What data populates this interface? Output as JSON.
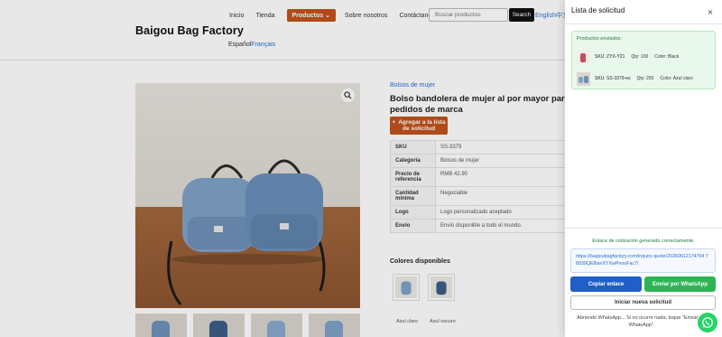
{
  "header": {
    "brand": "Baigou Bag Factory",
    "nav": [
      "Inicio",
      "Tienda"
    ],
    "nav_active": "Productos",
    "nav_active_caret": "⌄",
    "nav_more": [
      "Sobre nosotros",
      "Contáctanos"
    ],
    "search": {
      "placeholder": "Buscar productos",
      "button": "Search"
    },
    "lang_top": "English中文",
    "lang_bottom": {
      "es": "Español",
      "fr": "Français"
    }
  },
  "product": {
    "breadcrumb": "Bolsos de mujer",
    "title": "Bolso bandolera de mujer al por mayor para pedidos de marca",
    "add_button": {
      "plus": "+",
      "label": "Agregar a la lista de solicitud"
    },
    "specs": [
      {
        "key": "SKU",
        "value": "SS-3379"
      },
      {
        "key": "Categoría",
        "value": "Bolsos de mujer"
      },
      {
        "key": "Precio de referencia",
        "value": "RMB 42.90"
      },
      {
        "key": "Cantidad mínima",
        "value": "Negociable"
      },
      {
        "key": "Logo",
        "value": "Logo personalizado aceptado"
      },
      {
        "key": "Envío",
        "value": "Envío disponible a todo el mundo."
      }
    ],
    "colors_title": "Colores disponibles",
    "colors": [
      {
        "label": "Azul claro",
        "hex": "#7fa1c6"
      },
      {
        "label": "Azul oscuro",
        "hex": "#3d5d86"
      }
    ]
  },
  "drawer": {
    "title": "Lista de solicitud",
    "close": "×",
    "sent_label": "Productos enviados:",
    "items": [
      {
        "sku": "SKU: ZYX-Y21",
        "qty": "Qty: 100",
        "color": "Color: Black"
      },
      {
        "sku": "SKU: SS-3379-es",
        "qty": "Qty: 200",
        "color": "Color: Azul claro"
      }
    ],
    "link_status": "Enlace de cotización generado correctamente.",
    "link": "https://baigoubagfactory.com/inquiry-quote/20260612174704 78939QE8lanXYXwPnooFac7/",
    "copy_button": "Copiar enlace",
    "whatsapp_button": "Enviar por WhatsApp",
    "new_button": "Iniciar nueva solicitud",
    "whatsapp_note": "Abriendo WhatsApp... Si no ocurre nada, toque \"Enviar por WhatsApp\"."
  },
  "colors": {
    "accent": "#c2521c",
    "primary": "#1f5fc7",
    "whatsapp": "#2fb455",
    "success_bg": "#e9f8ec"
  },
  "icons": {
    "zoom": "magnifier-icon",
    "close": "close-icon",
    "whatsapp": "whatsapp-icon"
  }
}
